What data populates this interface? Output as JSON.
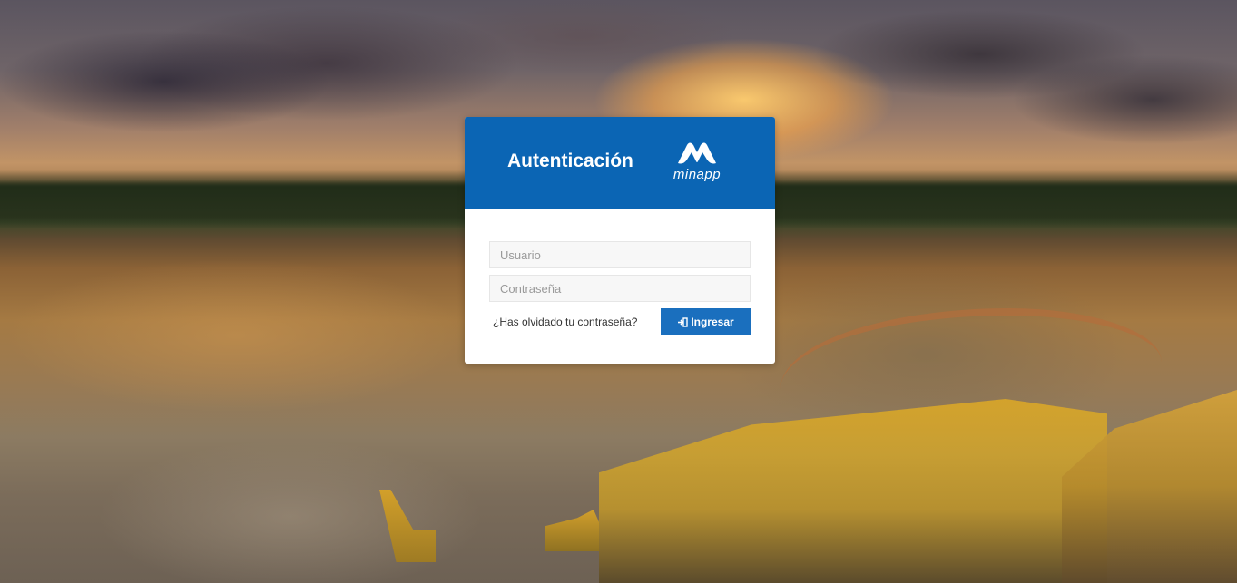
{
  "login": {
    "title": "Autenticación",
    "logo_text": "minapp",
    "username_placeholder": "Usuario",
    "password_placeholder": "Contraseña",
    "forgot_link": "¿Has olvidado tu contraseña?",
    "submit_label": "Ingresar",
    "submit_icon": "sign-in-icon"
  },
  "colors": {
    "header_blue": "#0b65b4",
    "button_blue": "#1a6fbe",
    "card_bg": "#ffffff"
  }
}
